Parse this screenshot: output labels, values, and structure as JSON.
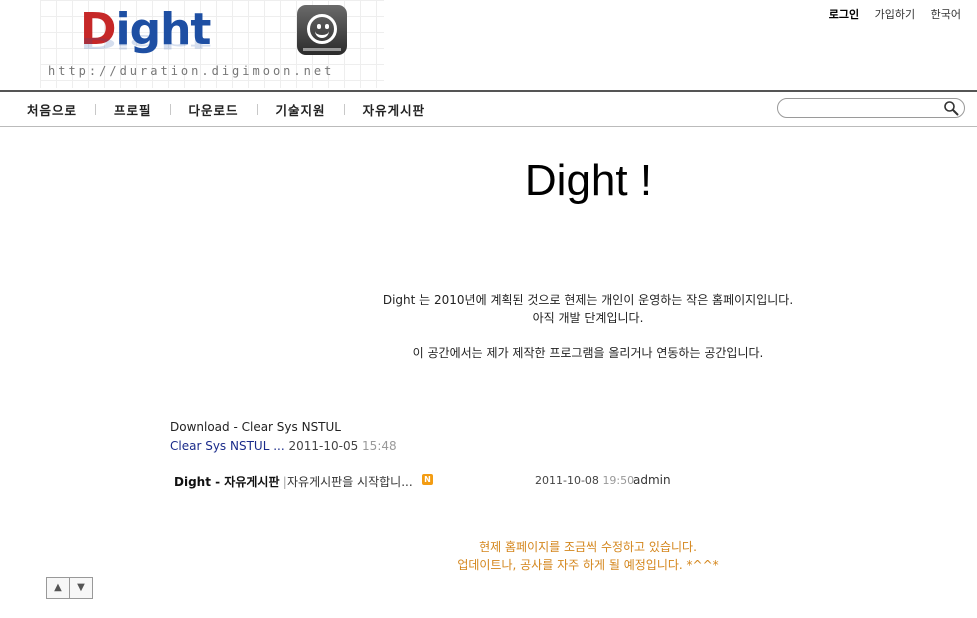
{
  "header": {
    "logo": {
      "first_letter": "D",
      "rest": "ight",
      "url": "http://duration.digimoon.net"
    },
    "top_links": {
      "login": "로그인",
      "signup": "가입하기",
      "language": "한국어"
    }
  },
  "nav": {
    "items": [
      {
        "label": "처음으로"
      },
      {
        "label": "프로필"
      },
      {
        "label": "다운로드"
      },
      {
        "label": "기술지원"
      },
      {
        "label": "자유게시판"
      }
    ],
    "search": {
      "value": "",
      "placeholder": ""
    }
  },
  "main": {
    "title": "Dight !",
    "intro": {
      "line1": "Dight 는 2010년에 계획된 것으로 현제는 개인이 운영하는 작은 홈페이지입니다.",
      "line2": "아직 개발 단계입니다.",
      "line3": "이 공간에서는 제가 제작한 프로그램을 올리거나 연동하는 공간입니다."
    },
    "download": {
      "title": "Download - Clear Sys NSTUL",
      "link": "Clear Sys NSTUL ...",
      "date": "2011-10-05",
      "time": "15:48"
    },
    "board": {
      "title": "Dight - 자유게시판",
      "separator": "|",
      "post": "자유게시판을 시작합니...",
      "badge": "N",
      "date": "2011-10-08",
      "time": "19:50",
      "author": "admin"
    },
    "notice": {
      "line1": "현제 홈페이지를 조금씩 수정하고 있습니다.",
      "line2": "업데이트나, 공사를 자주 하게 될 예정입니다. *^^*"
    },
    "scroll": {
      "up": "▲",
      "down": "▼"
    }
  },
  "colors": {
    "notice": "#d4861c",
    "link": "#1a2b8a",
    "badge": "#f39c12",
    "logo_red": "#c62828",
    "logo_blue": "#1e4fa3"
  }
}
